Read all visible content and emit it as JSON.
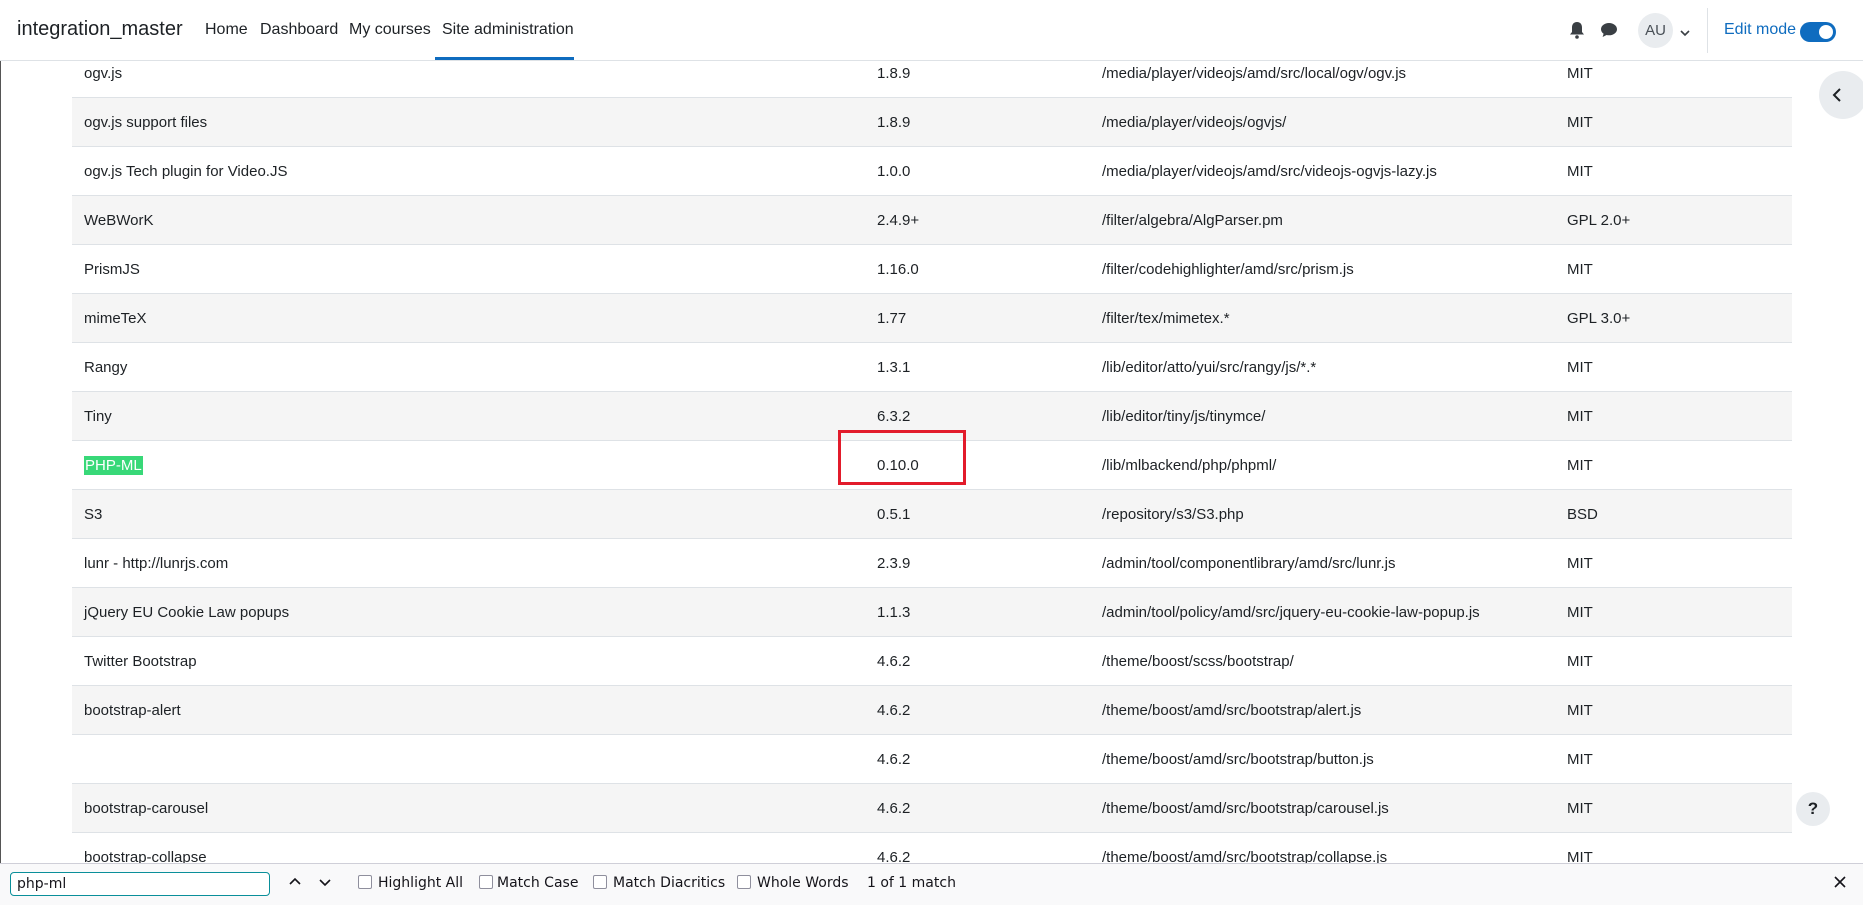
{
  "navbar": {
    "brand": "integration_master",
    "links": [
      {
        "label": "Home"
      },
      {
        "label": "Dashboard"
      },
      {
        "label": "My courses"
      },
      {
        "label": "Site administration",
        "active": true
      }
    ],
    "avatar_initials": "AU",
    "edit_mode_label": "Edit mode",
    "edit_mode_on": true,
    "accent_color": "#0f6cbf"
  },
  "table": {
    "rows": [
      {
        "name": "ogv.js",
        "version": "1.8.9",
        "location": "/media/player/videojs/amd/src/local/ogv/ogv.js",
        "license": "MIT"
      },
      {
        "name": "ogv.js support files",
        "version": "1.8.9",
        "location": "/media/player/videojs/ogvjs/",
        "license": "MIT"
      },
      {
        "name": "ogv.js Tech plugin for Video.JS",
        "version": "1.0.0",
        "location": "/media/player/videojs/amd/src/videojs-ogvjs-lazy.js",
        "license": "MIT"
      },
      {
        "name": "WeBWorK",
        "version": "2.4.9+",
        "location": "/filter/algebra/AlgParser.pm",
        "license": "GPL 2.0+"
      },
      {
        "name": "PrismJS",
        "version": "1.16.0",
        "location": "/filter/codehighlighter/amd/src/prism.js",
        "license": "MIT"
      },
      {
        "name": "mimeTeX",
        "version": "1.77",
        "location": "/filter/tex/mimetex.*",
        "license": "GPL 3.0+"
      },
      {
        "name": "Rangy",
        "version": "1.3.1",
        "location": "/lib/editor/atto/yui/src/rangy/js/*.*",
        "license": "MIT"
      },
      {
        "name": "Tiny",
        "version": "6.3.2",
        "location": "/lib/editor/tiny/js/tinymce/",
        "license": "MIT"
      },
      {
        "name": "PHP-ML",
        "version": "0.10.0",
        "location": "/lib/mlbackend/php/phpml/",
        "license": "MIT",
        "highlighted": true
      },
      {
        "name": "S3",
        "version": "0.5.1",
        "location": "/repository/s3/S3.php",
        "license": "BSD"
      },
      {
        "name": "lunr - http://lunrjs.com",
        "version": "2.3.9",
        "location": "/admin/tool/componentlibrary/amd/src/lunr.js",
        "license": "MIT"
      },
      {
        "name": "jQuery EU Cookie Law popups",
        "version": "1.1.3",
        "location": "/admin/tool/policy/amd/src/jquery-eu-cookie-law-popup.js",
        "license": "MIT"
      },
      {
        "name": "Twitter Bootstrap",
        "version": "4.6.2",
        "location": "/theme/boost/scss/bootstrap/",
        "license": "MIT"
      },
      {
        "name": "bootstrap-alert",
        "version": "4.6.2",
        "location": "/theme/boost/amd/src/bootstrap/alert.js",
        "license": "MIT"
      },
      {
        "name": "",
        "version": "4.6.2",
        "location": "/theme/boost/amd/src/bootstrap/button.js",
        "license": "MIT"
      },
      {
        "name": "bootstrap-carousel",
        "version": "4.6.2",
        "location": "/theme/boost/amd/src/bootstrap/carousel.js",
        "license": "MIT"
      },
      {
        "name": "bootstrap-collapse",
        "version": "4.6.2",
        "location": "/theme/boost/amd/src/bootstrap/collapse.js",
        "license": "MIT"
      }
    ],
    "highlight_color": "#38d878",
    "annotation_color": "#e21b2b"
  },
  "help_label": "?",
  "findbar": {
    "query": "php-ml",
    "options": [
      {
        "label": "Highlight All",
        "checked": false
      },
      {
        "label": "Match Case",
        "checked": false
      },
      {
        "label": "Match Diacritics",
        "checked": false
      },
      {
        "label": "Whole Words",
        "checked": false
      }
    ],
    "match_status": "1 of 1 match"
  }
}
